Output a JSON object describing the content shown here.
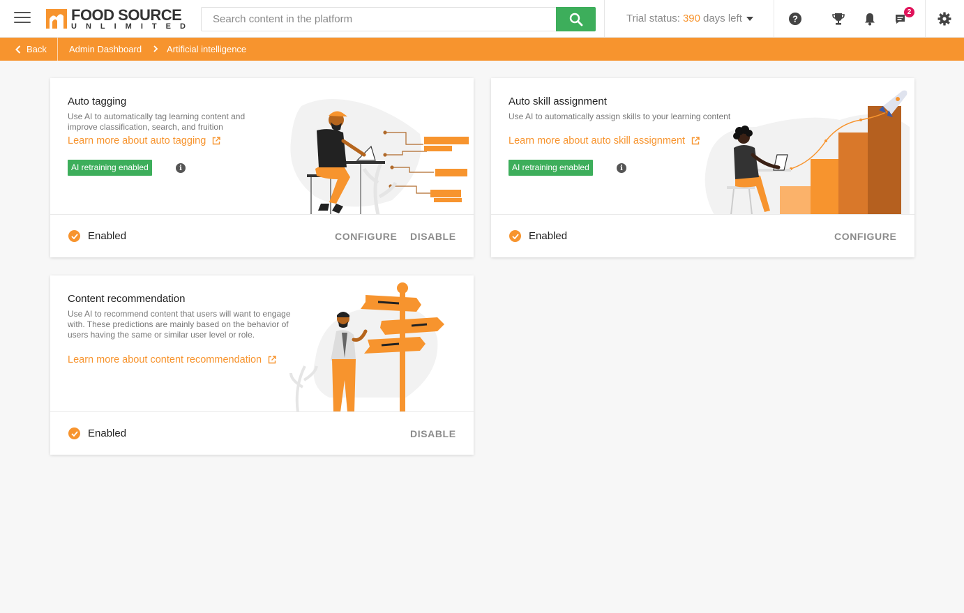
{
  "header": {
    "logo_title": "FOOD SOURCE",
    "logo_sub": "UNLIMITED",
    "search_placeholder": "Search content in the platform",
    "trial_prefix": "Trial status:",
    "trial_days": "390",
    "trial_suffix": "days left",
    "messages_badge": "2"
  },
  "breadcrumb": {
    "back_label": "Back",
    "items": [
      "Admin Dashboard",
      "Artificial intelligence"
    ]
  },
  "cards": [
    {
      "title": "Auto tagging",
      "description": "Use AI to automatically tag learning content and improve classification, search, and fruition",
      "link": "Learn more about auto tagging",
      "retrain_badge": "AI retraining enabled",
      "info": "i",
      "status": "Enabled",
      "actions": [
        "CONFIGURE",
        "DISABLE"
      ]
    },
    {
      "title": "Auto skill assignment",
      "description": "Use AI to automatically assign skills to your learning content",
      "link": "Learn more about auto skill assignment",
      "retrain_badge": "AI retraining enabled",
      "info": "i",
      "status": "Enabled",
      "actions": [
        "CONFIGURE"
      ]
    },
    {
      "title": "Content recommendation",
      "description": "Use AI to recommend content that users will want to engage with. These predictions are mainly based on the behavior of users having the same or similar user level or role.",
      "link": "Learn more about content recommendation",
      "status": "Enabled",
      "actions": [
        "DISABLE"
      ]
    }
  ],
  "colors": {
    "accent": "#f7942e",
    "success": "#3dae5b",
    "badge": "#e0135a"
  },
  "icons": [
    "menu-icon",
    "search-icon",
    "help-icon",
    "trophy-icon",
    "bell-icon",
    "chat-icon",
    "gear-icon",
    "chevron-left-icon",
    "chevron-right-icon",
    "external-link-icon",
    "check-circle-icon",
    "info-icon"
  ]
}
